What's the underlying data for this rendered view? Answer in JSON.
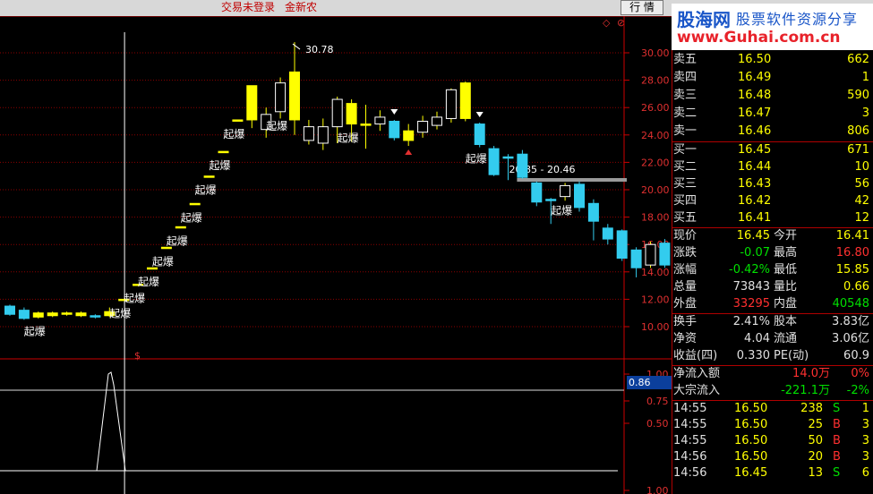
{
  "topbar": {
    "login_status": "交易未登录",
    "stock_name": "金新农",
    "quote_button": "行 情",
    "nav_icons": "◇ ⊘"
  },
  "watermark": {
    "brand": "股海网",
    "slogan": "股票软件资源分享",
    "url": "www.Guhai.com.cn"
  },
  "chart": {
    "price_axis": [
      "30.00",
      "28.00",
      "26.00",
      "24.00",
      "22.00",
      "20.00",
      "18.00",
      "16.00",
      "14.00",
      "12.00",
      "10.00"
    ],
    "indicator_axis": [
      "1.00",
      "0.75",
      "0.50",
      "1.00"
    ],
    "indicator_value": "0.86",
    "high_annotation": "30.78",
    "gap_annotation": "20.85 - 20.46",
    "signal_label": "起爆",
    "small_marker": "$",
    "colors": {
      "up": "#ffff00",
      "down": "#33ccee",
      "grid": "#8b0000",
      "frame": "#cc0000"
    }
  },
  "chart_data": {
    "type": "candlestick",
    "ylim": [
      9,
      32
    ],
    "candles": [
      {
        "o": 11.5,
        "c": 10.9,
        "h": 11.6,
        "l": 10.8
      },
      {
        "o": 11.2,
        "c": 10.6,
        "h": 11.4,
        "l": 10.5
      },
      {
        "o": 10.7,
        "c": 11.0,
        "h": 11.1,
        "l": 10.6
      },
      {
        "o": 10.8,
        "c": 11.0,
        "h": 11.1,
        "l": 10.7
      },
      {
        "o": 10.9,
        "c": 11.0,
        "h": 11.1,
        "l": 10.8
      },
      {
        "o": 10.8,
        "c": 11.0,
        "h": 11.1,
        "l": 10.7
      },
      {
        "o": 10.8,
        "c": 10.7,
        "h": 10.9,
        "l": 10.6
      },
      {
        "o": 10.8,
        "c": 11.1,
        "h": 11.4,
        "l": 10.7
      },
      {
        "o": 12.0,
        "c": 12.0,
        "h": 12.0,
        "l": 12.0
      },
      {
        "o": 13.1,
        "c": 13.1,
        "h": 13.1,
        "l": 13.1
      },
      {
        "o": 14.3,
        "c": 14.3,
        "h": 14.3,
        "l": 14.3
      },
      {
        "o": 15.8,
        "c": 15.8,
        "h": 15.8,
        "l": 15.8
      },
      {
        "o": 17.3,
        "c": 17.3,
        "h": 17.3,
        "l": 17.3
      },
      {
        "o": 19.0,
        "c": 19.0,
        "h": 19.0,
        "l": 19.0
      },
      {
        "o": 21.0,
        "c": 21.0,
        "h": 21.0,
        "l": 21.0
      },
      {
        "o": 22.8,
        "c": 22.8,
        "h": 22.8,
        "l": 22.8
      },
      {
        "o": 25.1,
        "c": 25.1,
        "h": 25.1,
        "l": 25.1
      },
      {
        "o": 25.1,
        "c": 27.6,
        "h": 27.6,
        "l": 24.5
      },
      {
        "o": 24.4,
        "c": 25.5,
        "h": 26.0,
        "l": 23.8
      },
      {
        "o": 25.7,
        "c": 27.8,
        "h": 28.2,
        "l": 25.2
      },
      {
        "o": 25.1,
        "c": 28.6,
        "h": 30.78,
        "l": 24.0
      },
      {
        "o": 23.6,
        "c": 24.6,
        "h": 25.1,
        "l": 23.3
      },
      {
        "o": 23.4,
        "c": 24.6,
        "h": 25.2,
        "l": 22.9
      },
      {
        "o": 24.6,
        "c": 26.6,
        "h": 26.8,
        "l": 23.4
      },
      {
        "o": 24.8,
        "c": 26.3,
        "h": 26.6,
        "l": 23.5
      },
      {
        "o": 24.7,
        "c": 24.8,
        "h": 26.2,
        "l": 23.0
      },
      {
        "o": 24.8,
        "c": 25.3,
        "h": 25.8,
        "l": 24.3
      },
      {
        "o": 25.0,
        "c": 23.8,
        "h": 25.1,
        "l": 23.6
      },
      {
        "o": 23.6,
        "c": 24.3,
        "h": 24.8,
        "l": 23.2
      },
      {
        "o": 24.2,
        "c": 25.0,
        "h": 25.4,
        "l": 23.8
      },
      {
        "o": 24.7,
        "c": 25.3,
        "h": 25.7,
        "l": 24.4
      },
      {
        "o": 25.2,
        "c": 27.3,
        "h": 27.4,
        "l": 24.9
      },
      {
        "o": 25.2,
        "c": 27.8,
        "h": 27.9,
        "l": 25.0
      },
      {
        "o": 24.8,
        "c": 23.3,
        "h": 24.9,
        "l": 23.1
      },
      {
        "o": 23.0,
        "c": 21.1,
        "h": 23.2,
        "l": 21.0
      },
      {
        "o": 22.4,
        "c": 22.3,
        "h": 22.6,
        "l": 20.7
      },
      {
        "o": 22.6,
        "c": 20.9,
        "h": 22.9,
        "l": 20.8
      },
      {
        "o": 20.5,
        "c": 19.1,
        "h": 20.6,
        "l": 18.8
      },
      {
        "o": 19.3,
        "c": 19.2,
        "h": 19.4,
        "l": 17.5
      },
      {
        "o": 19.5,
        "c": 20.3,
        "h": 20.5,
        "l": 19.2
      },
      {
        "o": 20.4,
        "c": 18.7,
        "h": 20.6,
        "l": 18.4
      },
      {
        "o": 19.0,
        "c": 17.7,
        "h": 19.3,
        "l": 16.3
      },
      {
        "o": 17.2,
        "c": 16.4,
        "h": 17.5,
        "l": 16.0
      },
      {
        "o": 17.0,
        "c": 15.0,
        "h": 17.1,
        "l": 14.8
      },
      {
        "o": 15.6,
        "c": 14.3,
        "h": 15.8,
        "l": 13.6
      },
      {
        "o": 14.5,
        "c": 16.0,
        "h": 16.2,
        "l": 14.3
      },
      {
        "o": 16.1,
        "c": 14.5,
        "h": 16.4,
        "l": 14.3
      }
    ],
    "signals": [
      2,
      8,
      9,
      10,
      11,
      12,
      13,
      14,
      15,
      16,
      19,
      24,
      33,
      39
    ],
    "markers_down": [
      27,
      33
    ],
    "marker_up": 28,
    "gap_band": [
      20.85,
      20.46
    ],
    "indicator_peak_index": 9
  },
  "quote_panel": {
    "asks": [
      {
        "label": "卖五",
        "price": "16.50",
        "vol": "662"
      },
      {
        "label": "卖四",
        "price": "16.49",
        "vol": "1"
      },
      {
        "label": "卖三",
        "price": "16.48",
        "vol": "590"
      },
      {
        "label": "卖二",
        "price": "16.47",
        "vol": "3"
      },
      {
        "label": "卖一",
        "price": "16.46",
        "vol": "806"
      }
    ],
    "bids": [
      {
        "label": "买一",
        "price": "16.45",
        "vol": "671"
      },
      {
        "label": "买二",
        "price": "16.44",
        "vol": "10"
      },
      {
        "label": "买三",
        "price": "16.43",
        "vol": "56"
      },
      {
        "label": "买四",
        "price": "16.42",
        "vol": "42"
      },
      {
        "label": "买五",
        "price": "16.41",
        "vol": "12"
      }
    ],
    "stats": [
      {
        "l1": "现价",
        "v1": "16.45",
        "c1": "yellow",
        "l2": "今开",
        "v2": "16.41",
        "c2": "yellow"
      },
      {
        "l1": "涨跌",
        "v1": "-0.07",
        "c1": "green",
        "l2": "最高",
        "v2": "16.80",
        "c2": "red"
      },
      {
        "l1": "涨幅",
        "v1": "-0.42%",
        "c1": "green",
        "l2": "最低",
        "v2": "15.85",
        "c2": "yellow"
      },
      {
        "l1": "总量",
        "v1": "73843",
        "c1": "white",
        "l2": "量比",
        "v2": "0.66",
        "c2": "yellow"
      },
      {
        "l1": "外盘",
        "v1": "33295",
        "c1": "red",
        "l2": "内盘",
        "v2": "40548",
        "c2": "green"
      }
    ],
    "finance": [
      {
        "l1": "换手",
        "v1": "2.41%",
        "l2": "股本",
        "v2": "3.83亿"
      },
      {
        "l1": "净资",
        "v1": "4.04",
        "l2": "流通",
        "v2": "3.06亿"
      },
      {
        "l1": "收益(四)",
        "v1": "0.330",
        "l2": "PE(动)",
        "v2": "60.9"
      }
    ],
    "flow": [
      {
        "label": "净流入额",
        "value": "14.0万",
        "value_color": "red",
        "pct": "0%",
        "pct_color": "red"
      },
      {
        "label": "大宗流入",
        "value": "-221.1万",
        "value_color": "green",
        "pct": "-2%",
        "pct_color": "green"
      }
    ],
    "ticks": [
      {
        "time": "14:55",
        "price": "16.50",
        "vol": "238",
        "side": "S",
        "side_color": "green",
        "n": "1"
      },
      {
        "time": "14:55",
        "price": "16.50",
        "vol": "25",
        "side": "B",
        "side_color": "red",
        "n": "3"
      },
      {
        "time": "14:55",
        "price": "16.50",
        "vol": "50",
        "side": "B",
        "side_color": "red",
        "n": "3"
      },
      {
        "time": "14:56",
        "price": "16.50",
        "vol": "20",
        "side": "B",
        "side_color": "red",
        "n": "3"
      },
      {
        "time": "14:56",
        "price": "16.45",
        "vol": "13",
        "side": "S",
        "side_color": "green",
        "n": "6"
      }
    ]
  }
}
